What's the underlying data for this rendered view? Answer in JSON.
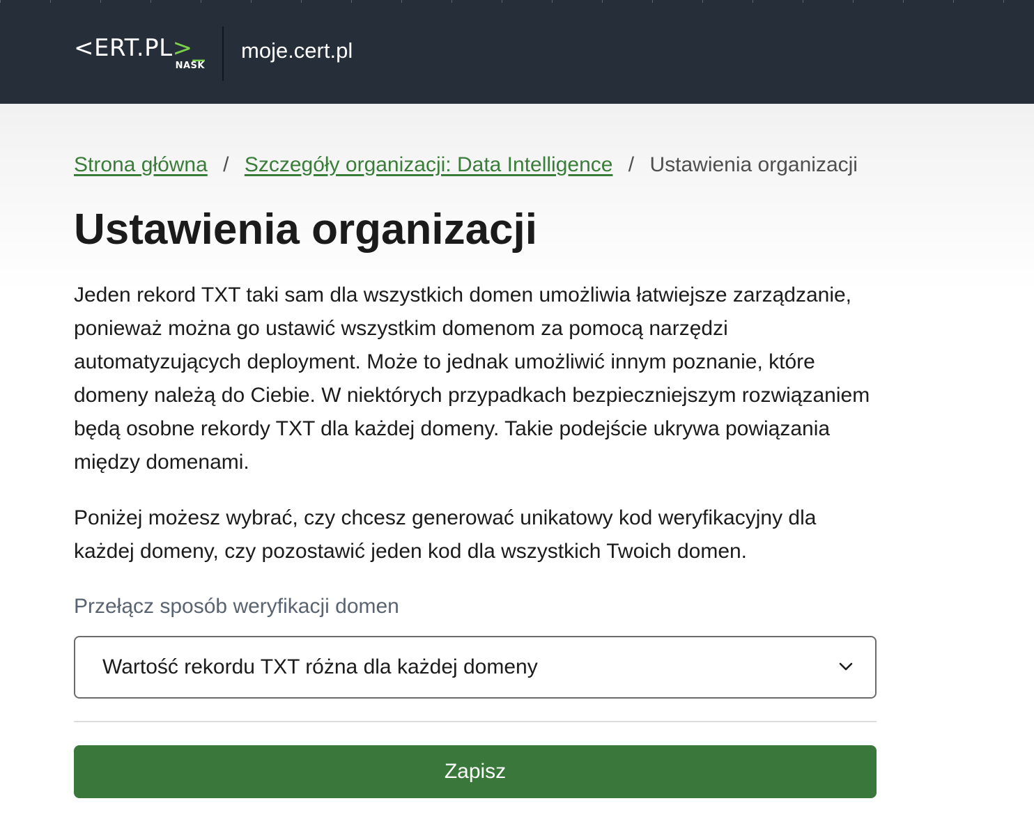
{
  "header": {
    "logo_text_main": "<ERT.PL",
    "logo_text_accent": ">_",
    "logo_sub": "NASK",
    "site_name": "moje.cert.pl",
    "background_color": "#252e39"
  },
  "breadcrumb": {
    "items": [
      {
        "label": "Strona główna",
        "link": true
      },
      {
        "label": "Szczegóły organizacji: Data Intelligence",
        "link": true
      },
      {
        "label": "Ustawienia organizacji",
        "link": false
      }
    ],
    "separator": "/"
  },
  "page": {
    "title": "Ustawienia organizacji",
    "paragraph1": "Jeden rekord TXT taki sam dla wszystkich domen umożliwia łatwiejsze zarządzanie, ponieważ można go ustawić wszystkim domenom za pomocą narzędzi automatyzujących deployment. Może to jednak umożliwić innym poznanie, które domeny należą do Ciebie. W niektórych przypadkach bezpieczniejszym rozwiązaniem będą osobne rekordy TXT dla każdej domeny. Takie podejście ukrywa powiązania między domenami.",
    "paragraph2": "Poniżej możesz wybrać, czy chcesz generować unikatowy kod weryfikacyjny dla każdej domeny, czy pozostawić jeden kod dla wszystkich Twoich domen."
  },
  "form": {
    "field_label": "Przełącz sposób weryfikacji domen",
    "select_value": "Wartość rekordu TXT różna dla każdej domeny",
    "select_icon": "chevron-down-icon",
    "save_label": "Zapisz",
    "save_color": "#3a773a",
    "link_color": "#3a7d3a"
  }
}
